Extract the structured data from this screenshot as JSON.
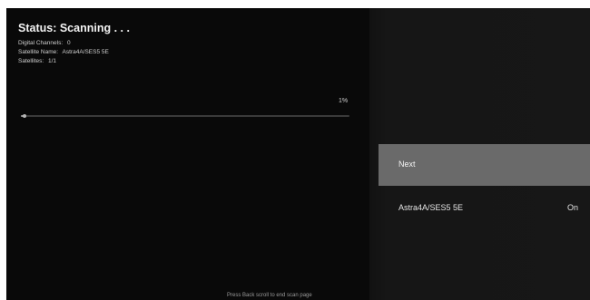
{
  "status": {
    "title": "Status: Scanning . . ."
  },
  "info": {
    "digital_channels_label": "Digital Channels:",
    "digital_channels_value": "0",
    "satellite_name_label": "Satellite Name:",
    "satellite_name_value": "Astra4A/SES5 5E",
    "satellites_label": "Satellites:",
    "satellites_value": "1/1"
  },
  "progress": {
    "percent_label": "1%",
    "value": 0.01
  },
  "menu": {
    "next_label": "Next",
    "satellite_name": "Astra4A/SES5 5E",
    "satellite_state": "On"
  },
  "footer": {
    "hint": "Press Back scroll to end scan page"
  },
  "colors": {
    "background": "#080808",
    "selected_item": "#6a6a6a",
    "text": "#e8e8e8"
  }
}
